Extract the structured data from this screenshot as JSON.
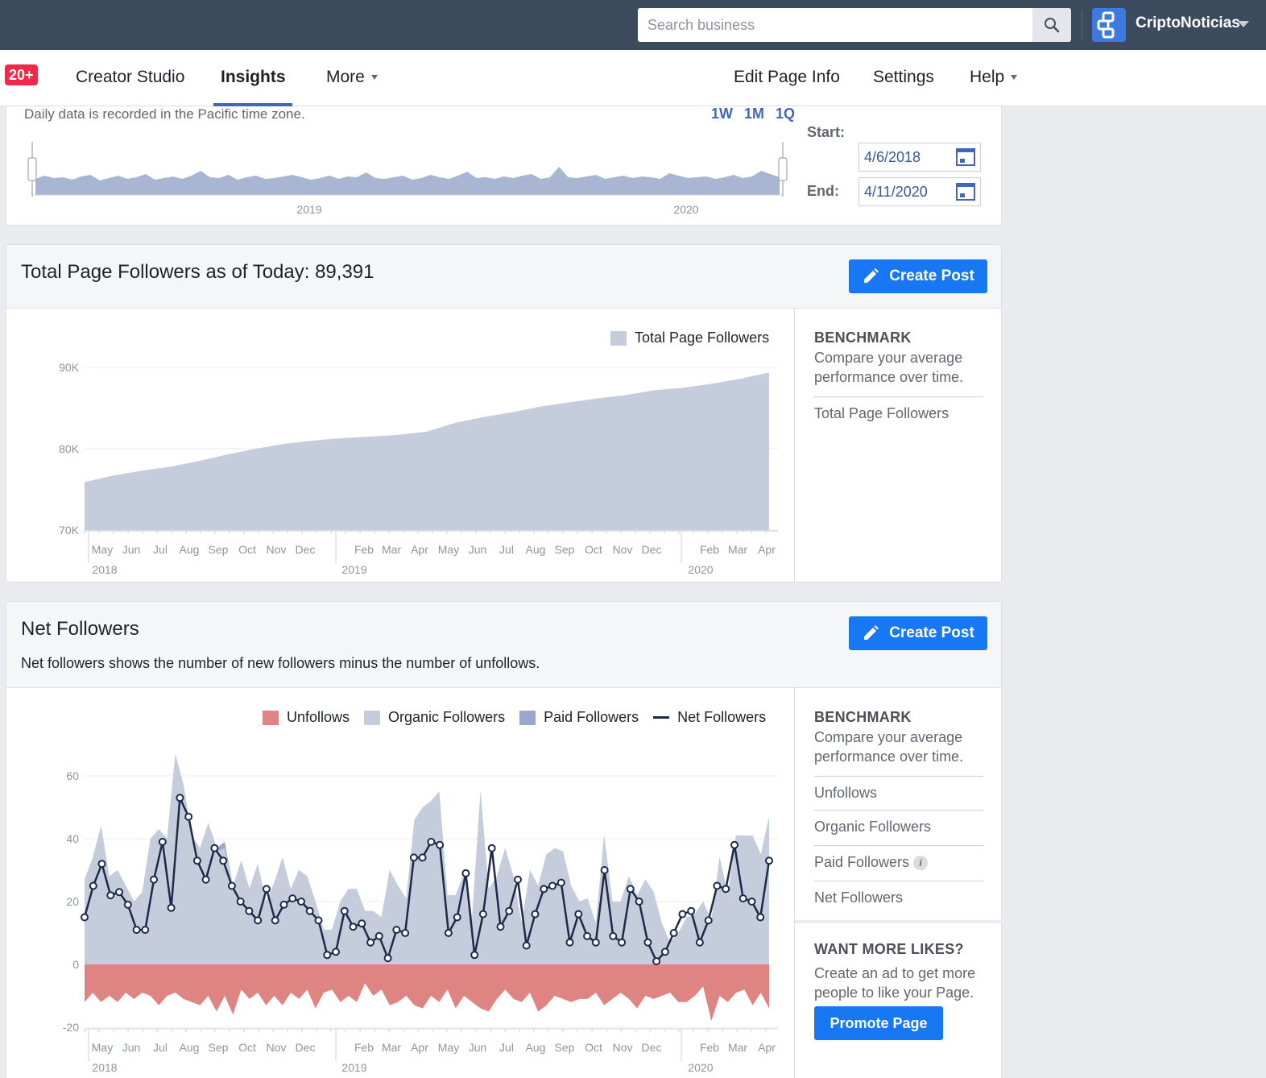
{
  "topbar": {
    "search_placeholder": "Search business",
    "page_name": "CriptoNoticias"
  },
  "nav": {
    "badge": "20+",
    "creator_studio": "Creator Studio",
    "insights": "Insights",
    "more": "More",
    "edit_page_info": "Edit Page Info",
    "settings": "Settings",
    "help": "Help"
  },
  "range": {
    "note": "Daily data is recorded in the Pacific time zone.",
    "presets": [
      "1W",
      "1M",
      "1Q"
    ],
    "start_label": "Start:",
    "start_value": "4/6/2018",
    "end_label": "End:",
    "end_value": "4/11/2020",
    "year_labels": [
      "2019",
      "2020"
    ]
  },
  "followers_card": {
    "title": "Total Page Followers as of Today: 89,391",
    "create_post": "Create Post",
    "legend": "Total Page Followers",
    "benchmark_title": "BENCHMARK",
    "benchmark_text": "Compare your average performance over time.",
    "benchmark_items": [
      "Total Page Followers"
    ]
  },
  "net_card": {
    "title": "Net Followers",
    "description": "Net followers shows the number of new followers minus the number of unfollows.",
    "create_post": "Create Post",
    "legend": [
      "Unfollows",
      "Organic Followers",
      "Paid Followers",
      "Net Followers"
    ],
    "benchmark_title": "BENCHMARK",
    "benchmark_text": "Compare your average performance over time.",
    "benchmark_items": [
      "Unfollows",
      "Organic Followers",
      "Paid Followers",
      "Net Followers"
    ],
    "promo_title": "WANT MORE LIKES?",
    "promo_text": "Create an ad to get more people to like your Page.",
    "promote_button": "Promote Page"
  },
  "colors": {
    "accent": "#1877f2",
    "area_fill": "#c5cddd",
    "unfollows": "#de8483",
    "paid": "#9ca8c9",
    "net_line": "#1d2b4b"
  },
  "chart_data": [
    {
      "type": "area",
      "title": "Total Page Followers",
      "ylim": [
        70000,
        90000
      ],
      "y_ticks": [
        "70K",
        "80K",
        "90K"
      ],
      "x_ticks": [
        "May",
        "Jun",
        "Jul",
        "Aug",
        "Sep",
        "Oct",
        "Nov",
        "Dec",
        "Feb",
        "Mar",
        "Apr",
        "May",
        "Jun",
        "Jul",
        "Aug",
        "Sep",
        "Oct",
        "Nov",
        "Dec",
        "Feb",
        "Mar",
        "Apr"
      ],
      "year_labels": [
        "2018",
        "2019",
        "2020"
      ],
      "x": [
        "2018-04",
        "2018-05",
        "2018-06",
        "2018-07",
        "2018-08",
        "2018-09",
        "2018-10",
        "2018-11",
        "2018-12",
        "2019-01",
        "2019-02",
        "2019-03",
        "2019-04",
        "2019-05",
        "2019-06",
        "2019-07",
        "2019-08",
        "2019-09",
        "2019-10",
        "2019-11",
        "2019-12",
        "2020-01",
        "2020-02",
        "2020-03",
        "2020-04"
      ],
      "series": [
        {
          "name": "Total Page Followers",
          "values": [
            75900,
            76700,
            77300,
            77800,
            78500,
            79300,
            80000,
            80600,
            81000,
            81300,
            81500,
            81700,
            82100,
            83200,
            83900,
            84500,
            85200,
            85700,
            86200,
            86600,
            87200,
            87500,
            88000,
            88600,
            89391
          ]
        }
      ]
    },
    {
      "type": "area",
      "title": "Net Followers",
      "ylim": [
        -20,
        60
      ],
      "y_ticks": [
        "-20",
        "0",
        "20",
        "40",
        "60"
      ],
      "x_ticks": [
        "May",
        "Jun",
        "Jul",
        "Aug",
        "Sep",
        "Oct",
        "Nov",
        "Dec",
        "Feb",
        "Mar",
        "Apr",
        "May",
        "Jun",
        "Jul",
        "Aug",
        "Sep",
        "Oct",
        "Nov",
        "Dec",
        "Feb",
        "Mar",
        "Apr"
      ],
      "year_labels": [
        "2018",
        "2019",
        "2020"
      ],
      "series": [
        {
          "name": "Organic Followers",
          "values": [
            27,
            34,
            44,
            28,
            30,
            25,
            20,
            23,
            40,
            43,
            40,
            67,
            57,
            41,
            37,
            45,
            36,
            37,
            25,
            33,
            24,
            32,
            20,
            26,
            34,
            24,
            30,
            28,
            20,
            11,
            11,
            20,
            24,
            24,
            17,
            17,
            15,
            30,
            25,
            21,
            46,
            50,
            52,
            55,
            22,
            22,
            29,
            15,
            55,
            24,
            28,
            37,
            28,
            13,
            30,
            25,
            35,
            37,
            36,
            25,
            20,
            21,
            13,
            41,
            20,
            20,
            28,
            22,
            27,
            23,
            13,
            7,
            10,
            15,
            16,
            20,
            14,
            34,
            22,
            41,
            41,
            41,
            35,
            47
          ]
        },
        {
          "name": "Paid Followers",
          "values": [
            0,
            0,
            0,
            0,
            0,
            0,
            0,
            0,
            0,
            0,
            0,
            0,
            0,
            0,
            0,
            0,
            1,
            2,
            0,
            0,
            0,
            0,
            0,
            0,
            0,
            0,
            0,
            0,
            0,
            0,
            0,
            0,
            0,
            0,
            0,
            0,
            0,
            0,
            0,
            0,
            0,
            0,
            0,
            0,
            0,
            0,
            0,
            0,
            0,
            0,
            0,
            0,
            0,
            0,
            0,
            0,
            0,
            0,
            0,
            0,
            0,
            0,
            0,
            0,
            0,
            0,
            0,
            0,
            0,
            0,
            0,
            0,
            0,
            0,
            0,
            0,
            0,
            0,
            0,
            0,
            0,
            0,
            0,
            0
          ]
        },
        {
          "name": "Unfollows",
          "values": [
            -12,
            -9,
            -12,
            -10,
            -12,
            -9,
            -11,
            -9,
            -10,
            -13,
            -10,
            -9,
            -11,
            -12,
            -13,
            -10,
            -15,
            -10,
            -16,
            -8,
            -11,
            -9,
            -13,
            -10,
            -13,
            -9,
            -11,
            -8,
            -14,
            -9,
            -8,
            -12,
            -10,
            -12,
            -6,
            -10,
            -8,
            -13,
            -12,
            -10,
            -13,
            -14,
            -10,
            -12,
            -8,
            -14,
            -10,
            -12,
            -14,
            -15,
            -11,
            -8,
            -11,
            -12,
            -9,
            -15,
            -13,
            -10,
            -11,
            -12,
            -11,
            -11,
            -9,
            -13,
            -11,
            -9,
            -11,
            -14,
            -10,
            -11,
            -10,
            -9,
            -12,
            -12,
            -10,
            -7,
            -18,
            -10,
            -12,
            -9,
            -8,
            -13,
            -9,
            -14
          ]
        },
        {
          "name": "Net Followers",
          "values": [
            15,
            25,
            32,
            22,
            23,
            19,
            11,
            11,
            27,
            39,
            18,
            53,
            47,
            33,
            27,
            37,
            33,
            25,
            20,
            17,
            14,
            24,
            14,
            19,
            21,
            20,
            17,
            14,
            3,
            4,
            17,
            12,
            13,
            7,
            9,
            2,
            11,
            10,
            34,
            34,
            39,
            38,
            10,
            15,
            29,
            3,
            16,
            37,
            12,
            17,
            27,
            6,
            16,
            24,
            25,
            26,
            7,
            16,
            9,
            7,
            30,
            9,
            7,
            24,
            20,
            7,
            1,
            4,
            10,
            16,
            17,
            7,
            14,
            25,
            24,
            38,
            21,
            20,
            15,
            33
          ]
        }
      ]
    }
  ],
  "overview_chart": {
    "type": "area",
    "values": [
      20,
      24,
      21,
      22,
      19,
      23,
      25,
      18,
      21,
      24,
      20,
      22,
      26,
      19,
      21,
      23,
      20,
      24,
      30,
      22,
      21,
      25,
      19,
      22,
      24,
      20,
      21,
      23,
      25,
      22,
      19,
      21,
      24,
      20,
      23,
      22,
      28,
      21,
      20,
      22,
      24,
      19,
      21,
      25,
      22,
      20,
      24,
      29,
      21,
      22,
      20,
      23,
      21,
      24,
      26,
      20,
      22,
      35,
      22,
      21,
      23,
      25,
      20,
      22,
      24,
      21,
      23,
      22,
      20,
      27,
      24,
      21,
      22,
      23,
      20,
      22,
      25,
      21,
      23,
      30,
      26,
      22
    ]
  }
}
